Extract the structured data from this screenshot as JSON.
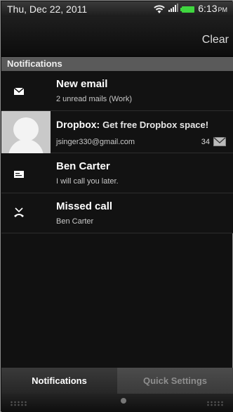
{
  "status_bar": {
    "date": "Thu, Dec 22, 2011",
    "time": "6:13",
    "ampm": "PM",
    "battery_color": "#3fd63f"
  },
  "header": {
    "clear_label": "Clear"
  },
  "section": {
    "label": "Notifications"
  },
  "notifications": [
    {
      "icon": "envelope-icon",
      "title": "New email",
      "subtitle": "2 unread mails (Work)"
    },
    {
      "icon": "avatar",
      "title_app": "Dropbox:",
      "title_text": "Get free Dropbox space!",
      "subtitle": "jsinger330@gmail.com",
      "count": "34",
      "badge_icon": "mail-icon"
    },
    {
      "icon": "message-icon",
      "title": "Ben Carter",
      "subtitle": "I will call you later."
    },
    {
      "icon": "missed-call-icon",
      "title": "Missed call",
      "subtitle": "Ben Carter"
    }
  ],
  "tabs": {
    "notifications": "Notifications",
    "quick_settings": "Quick Settings"
  }
}
